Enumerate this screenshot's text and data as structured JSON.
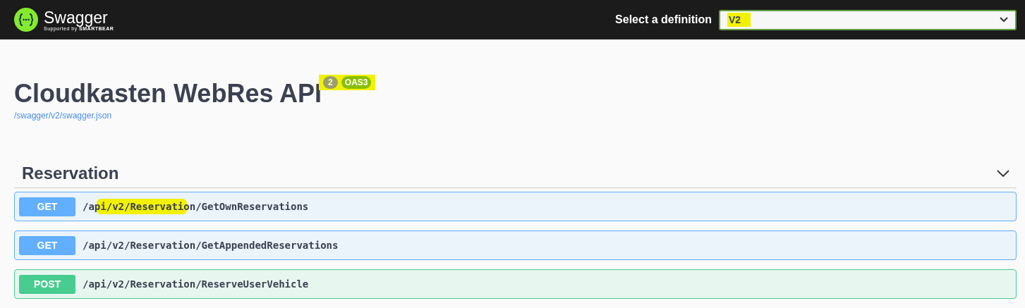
{
  "topbar": {
    "logo": {
      "name": "Swagger",
      "tagline": "Supported by",
      "brand": "SMARTBEAR"
    },
    "definition_label": "Select a definition",
    "definition": {
      "value": "V2",
      "highlighted": true
    }
  },
  "info": {
    "title": "Cloudkasten WebRes API",
    "version": "2",
    "spec": "OAS3",
    "badges_highlighted": true,
    "link": "/swagger/v2/swagger.json"
  },
  "section": {
    "name": "Reservation",
    "expanded": true,
    "operations": [
      {
        "method": "GET",
        "path": "/api/v2/Reservation/GetOwnReservations",
        "highlighted": true
      },
      {
        "method": "GET",
        "path": "/api/v2/Reservation/GetAppendedReservations",
        "highlighted": false
      },
      {
        "method": "POST",
        "path": "/api/v2/Reservation/ReserveUserVehicle",
        "highlighted": false
      }
    ]
  }
}
